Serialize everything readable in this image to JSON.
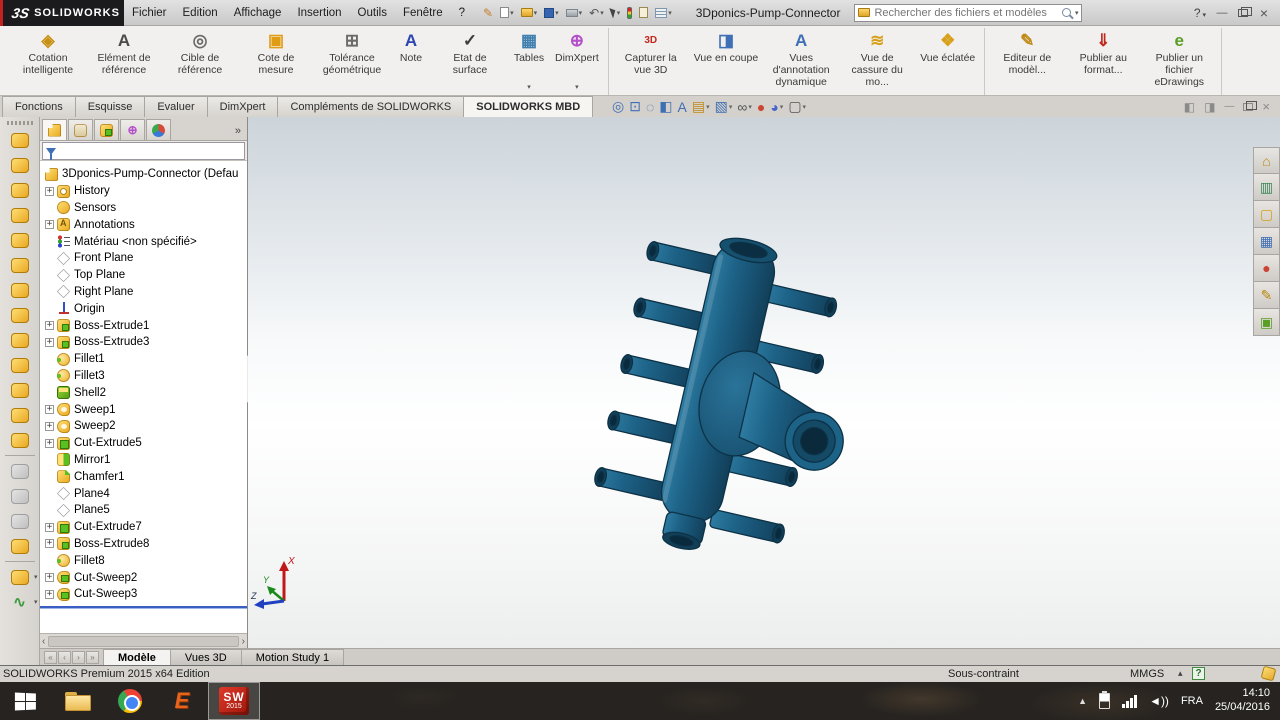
{
  "titlebar": {
    "logo_mark": "3S",
    "logo_text": "SOLIDWORKS",
    "menus": [
      "Fichier",
      "Edition",
      "Affichage",
      "Insertion",
      "Outils",
      "Fenêtre",
      "?"
    ],
    "doc_title": "3Dponics-Pump-Connector",
    "search": {
      "placeholder": "Rechercher des fichiers et modèles"
    }
  },
  "ribbon": {
    "groups": [
      {
        "name": "annotations",
        "buttons": [
          {
            "label": "Cotation intelligente",
            "icon": "smart-dimension",
            "glyph": "◈",
            "color": "#c79114",
            "dropdown": false
          },
          {
            "label": "Elément de référence",
            "icon": "datum-feature",
            "glyph": "A",
            "color": "#4a4a4a",
            "dropdown": false
          },
          {
            "label": "Cible de référence",
            "icon": "datum-target",
            "glyph": "◎",
            "color": "#6b6b6b",
            "dropdown": false
          },
          {
            "label": "Cote de mesure",
            "icon": "measure-dimension",
            "glyph": "▣",
            "color": "#e09c12",
            "dropdown": false
          },
          {
            "label": "Tolérance géométrique",
            "icon": "geometric-tolerance",
            "glyph": "⊞",
            "color": "#6b6b6b",
            "dropdown": false
          },
          {
            "label": "Note",
            "icon": "note",
            "glyph": "A",
            "color": "#2c45b0",
            "dropdown": false
          },
          {
            "label": "Etat de surface",
            "icon": "surface-finish",
            "glyph": "✓",
            "color": "#3d3d3d",
            "dropdown": false
          },
          {
            "label": "Tables",
            "icon": "tables",
            "glyph": "▦",
            "color": "#3f7fae",
            "dropdown": true
          },
          {
            "label": "DimXpert",
            "icon": "dimxpert",
            "glyph": "⊕",
            "color": "#b44fc9",
            "dropdown": true
          }
        ]
      },
      {
        "name": "mbd-views",
        "buttons": [
          {
            "label": "Capturer la vue 3D",
            "icon": "capture-3d-view",
            "glyph": "3D",
            "color": "#c0271d",
            "dropdown": false,
            "small": true
          },
          {
            "label": "Vue en coupe",
            "icon": "section-view",
            "glyph": "◨",
            "color": "#3f6fb5",
            "dropdown": false
          },
          {
            "label": "Vues d'annotation dynamique",
            "icon": "dynamic-annotation-views",
            "glyph": "A",
            "color": "#3f6fb5",
            "dropdown": false
          },
          {
            "label": "Vue de cassure du mo...",
            "icon": "break-view",
            "glyph": "≋",
            "color": "#d8a018",
            "dropdown": false
          },
          {
            "label": "Vue éclatée",
            "icon": "exploded-view",
            "glyph": "❖",
            "color": "#d8a018",
            "dropdown": false
          }
        ]
      },
      {
        "name": "publish",
        "buttons": [
          {
            "label": "Editeur de modèl...",
            "icon": "template-editor",
            "glyph": "✎",
            "color": "#c08a18",
            "dropdown": false
          },
          {
            "label": "Publier au format...",
            "icon": "publish-3d-pdf",
            "glyph": "⇓",
            "color": "#c0271d",
            "dropdown": false
          },
          {
            "label": "Publier un fichier eDrawings",
            "icon": "publish-edrawings",
            "glyph": "e",
            "color": "#5a9e26",
            "dropdown": false
          }
        ]
      }
    ],
    "tabs": [
      {
        "label": "Fonctions",
        "active": false
      },
      {
        "label": "Esquisse",
        "active": false
      },
      {
        "label": "Evaluer",
        "active": false
      },
      {
        "label": "DimXpert",
        "active": false
      },
      {
        "label": "Compléments de SOLIDWORKS",
        "active": false
      },
      {
        "label": "SOLIDWORKS MBD",
        "active": true
      }
    ]
  },
  "headsup": {
    "icons": [
      {
        "name": "zoom-to-fit",
        "glyph": "◎",
        "color": "#3f6fb5",
        "dropdown": false
      },
      {
        "name": "zoom-to-area",
        "glyph": "⊡",
        "color": "#3f6fb5",
        "dropdown": false
      },
      {
        "name": "magnified-selection",
        "glyph": "◌",
        "color": "#3f6fb5",
        "dropdown": false
      },
      {
        "name": "section-view",
        "glyph": "◧",
        "color": "#3f6fb5",
        "dropdown": false
      },
      {
        "name": "dynamic-annotation-views",
        "glyph": "A",
        "color": "#3f6fb5",
        "dropdown": false
      },
      {
        "name": "edit-appearance",
        "glyph": "▤",
        "color": "#c08a18",
        "dropdown": true
      },
      {
        "name": "view-orientation",
        "glyph": "▧",
        "color": "#3f6fb5",
        "dropdown": true
      },
      {
        "name": "display-style",
        "glyph": "∞",
        "color": "#555555",
        "dropdown": true
      },
      {
        "name": "appearance-ball",
        "glyph": "●",
        "color": "#cc4433",
        "dropdown": false
      },
      {
        "name": "hide-show-items",
        "glyph": "◕",
        "color": "#4466cc",
        "dropdown": true
      },
      {
        "name": "view-settings",
        "glyph": "▢",
        "color": "#555555",
        "dropdown": true
      }
    ]
  },
  "left_toolbar": {
    "items": [
      {
        "type": "gold"
      },
      {
        "type": "gold"
      },
      {
        "type": "gold"
      },
      {
        "type": "gold"
      },
      {
        "type": "gold"
      },
      {
        "type": "gold"
      },
      {
        "type": "gold"
      },
      {
        "type": "gold"
      },
      {
        "type": "gold"
      },
      {
        "type": "gold"
      },
      {
        "type": "gold"
      },
      {
        "type": "gold"
      },
      {
        "type": "gold"
      },
      {
        "type": "sep"
      },
      {
        "type": "gray"
      },
      {
        "type": "gray"
      },
      {
        "type": "gray"
      },
      {
        "type": "gold"
      },
      {
        "type": "sep"
      },
      {
        "type": "gold",
        "dropdown": true
      },
      {
        "type": "green",
        "glyph": "∿",
        "dropdown": true
      }
    ]
  },
  "feature_tree": {
    "root": "3Dponics-Pump-Connector  (Defau",
    "items": [
      {
        "label": "History",
        "icon": "history",
        "expand": true
      },
      {
        "label": "Sensors",
        "icon": "sensors",
        "expand": false
      },
      {
        "label": "Annotations",
        "icon": "annotations",
        "expand": true
      },
      {
        "label": "Matériau <non spécifié>",
        "icon": "material",
        "expand": false
      },
      {
        "label": "Front Plane",
        "icon": "plane",
        "expand": false
      },
      {
        "label": "Top Plane",
        "icon": "plane",
        "expand": false
      },
      {
        "label": "Right Plane",
        "icon": "plane",
        "expand": false
      },
      {
        "label": "Origin",
        "icon": "origin",
        "expand": false
      },
      {
        "label": "Boss-Extrude1",
        "icon": "boss-extrude",
        "expand": true
      },
      {
        "label": "Boss-Extrude3",
        "icon": "boss-extrude",
        "expand": true
      },
      {
        "label": "Fillet1",
        "icon": "fillet",
        "expand": false
      },
      {
        "label": "Fillet3",
        "icon": "fillet",
        "expand": false
      },
      {
        "label": "Shell2",
        "icon": "shell",
        "expand": false
      },
      {
        "label": "Sweep1",
        "icon": "sweep",
        "expand": true
      },
      {
        "label": "Sweep2",
        "icon": "sweep",
        "expand": true
      },
      {
        "label": "Cut-Extrude5",
        "icon": "cut-extrude",
        "expand": true
      },
      {
        "label": "Mirror1",
        "icon": "mirror",
        "expand": false
      },
      {
        "label": "Chamfer1",
        "icon": "chamfer",
        "expand": false
      },
      {
        "label": "Plane4",
        "icon": "plane",
        "expand": false
      },
      {
        "label": "Plane5",
        "icon": "plane",
        "expand": false
      },
      {
        "label": "Cut-Extrude7",
        "icon": "cut-extrude",
        "expand": true
      },
      {
        "label": "Boss-Extrude8",
        "icon": "boss-extrude",
        "expand": true
      },
      {
        "label": "Fillet8",
        "icon": "fillet",
        "expand": false
      },
      {
        "label": "Cut-Sweep2",
        "icon": "cut-sweep",
        "expand": true
      },
      {
        "label": "Cut-Sweep3",
        "icon": "cut-sweep",
        "expand": true
      }
    ]
  },
  "taskpane": {
    "icons": [
      {
        "name": "home",
        "glyph": "⌂",
        "color": "#c08a18"
      },
      {
        "name": "solidworks-resources",
        "glyph": "▥",
        "color": "#3a8a5a"
      },
      {
        "name": "design-library",
        "glyph": "▢",
        "color": "#d8a018"
      },
      {
        "name": "file-explorer",
        "glyph": "▦",
        "color": "#3f6fb5"
      },
      {
        "name": "appearances-scenes",
        "glyph": "●",
        "color": "#cc4433"
      },
      {
        "name": "custom-properties",
        "glyph": "✎",
        "color": "#b8860b"
      },
      {
        "name": "solidworks-forum",
        "glyph": "▣",
        "color": "#5a9e26"
      }
    ]
  },
  "viewport": {
    "model_color": "#1c5e80",
    "triad": {
      "x": "X",
      "y": "Y",
      "z": "Z"
    }
  },
  "model_tabs": {
    "tabs": [
      {
        "label": "Modèle",
        "active": true
      },
      {
        "label": "Vues 3D",
        "active": false
      },
      {
        "label": "Motion Study 1",
        "active": false
      }
    ]
  },
  "status_bar": {
    "left": "SOLIDWORKS Premium 2015 x64 Edition",
    "constraint": "Sous-contraint",
    "units": "MMGS"
  },
  "taskbar": {
    "sw": {
      "label": "SW",
      "year": "2015"
    },
    "tray": {
      "lang": "FRA",
      "time": "14:10",
      "date": "25/04/2016"
    }
  }
}
